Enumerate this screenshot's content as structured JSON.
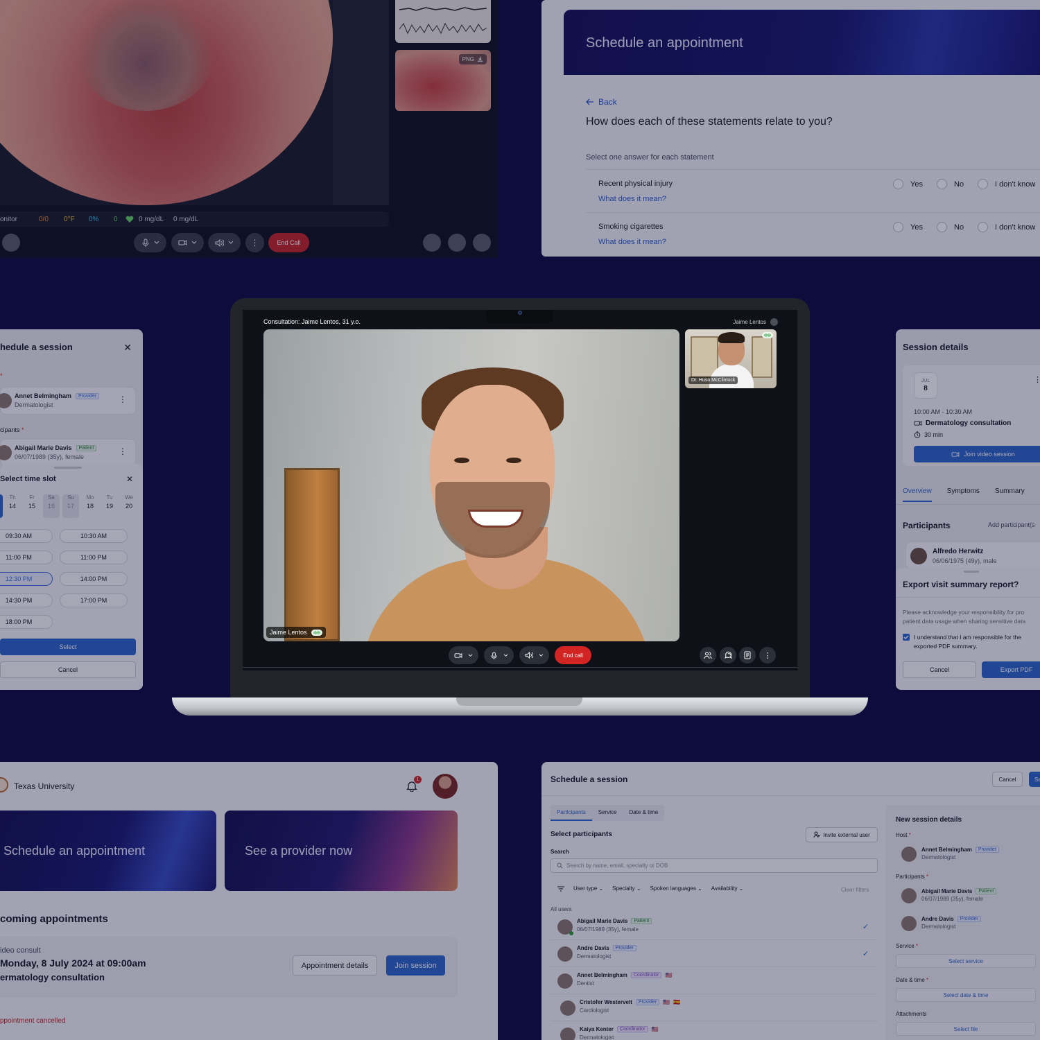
{
  "telehealth": {
    "vitals_label": "onitor",
    "vitals": [
      "0/0",
      "0°F",
      "0%",
      "0",
      "0 mg/dL",
      "0 mg/dL"
    ],
    "thumb_badge": "PNG",
    "end_call": "End Call"
  },
  "questionnaire": {
    "title": "Schedule an appointment",
    "back": "Back",
    "question": "How does each of these statements relate to you?",
    "hint": "Select one answer for each statement",
    "options": [
      "Yes",
      "No",
      "I don't know"
    ],
    "statements": [
      {
        "label": "Recent physical injury",
        "link": "What does it mean?"
      },
      {
        "label": "Smoking cigarettes",
        "link": "What does it mean?"
      }
    ]
  },
  "call": {
    "consultation": "Consultation: Jaime Lentos, 31 y.o.",
    "top_right_name": "Jaime Lentos",
    "main_name": "Jaime Lentos",
    "pip_name": "Dr. Huso McClintock",
    "end_call": "End call"
  },
  "time_slot": {
    "title": "hedule a session",
    "host": {
      "name": "Annet Belmingham",
      "badge": "Provider",
      "sub": "Dermatologist"
    },
    "participants_label": "cipants",
    "participant": {
      "name": "Abigail Marie Davis",
      "badge": "Patient",
      "sub": "06/07/1989 (35y), female"
    },
    "sheet_title": "Select time slot",
    "days": [
      {
        "d": "Th",
        "n": "14"
      },
      {
        "d": "Fr",
        "n": "15"
      },
      {
        "d": "Sa",
        "n": "16"
      },
      {
        "d": "Su",
        "n": "17"
      },
      {
        "d": "Mo",
        "n": "18"
      },
      {
        "d": "Tu",
        "n": "19"
      },
      {
        "d": "We",
        "n": "20"
      }
    ],
    "slots": [
      "09:30 AM",
      "10:30 AM",
      "11:00 PM",
      "11:00 PM",
      "12:30 PM",
      "14:00 PM",
      "14:30 PM",
      "17:00 PM",
      "18:00 PM"
    ],
    "selected_slot": "12:30 PM",
    "select": "Select",
    "cancel": "Cancel"
  },
  "session_details": {
    "title": "Session details",
    "month": "JUL",
    "day": "8",
    "time": "10:00 AM - 10:30 AM",
    "type": "Dermatology consultation",
    "duration": "30 min",
    "join": "Join video session",
    "tabs": [
      "Overview",
      "Symptoms",
      "Summary"
    ],
    "participants": "Participants",
    "add": "Add participant(s",
    "participant": {
      "name": "Alfredo Herwitz",
      "sub": "06/06/1975 (49y), male"
    },
    "export_title": "Export visit summary report?",
    "export_text": [
      "Please acknowledge your responsibility for pro",
      "patient data usage when sharing sensitive data"
    ],
    "checkbox": [
      "I understand that I am responsible for the",
      "exported PDF summary."
    ],
    "cancel": "Cancel",
    "export": "Export PDF"
  },
  "dashboard": {
    "org": "Texas University",
    "notifications": "1",
    "cta_1": "Schedule an appointment",
    "cta_2": "See a provider now",
    "upcoming": "coming appointments",
    "apt_kind": "ideo consult",
    "apt_date": "Monday, 8 July 2024 at 09:00am",
    "apt_title": "ermatology consultation",
    "apt_details": "Appointment details",
    "join": "Join session",
    "cancelled": "ppointment cancelled"
  },
  "schedule_session": {
    "title": "Schedule a session",
    "cancel": "Cancel",
    "save": "Sa",
    "tabs": [
      "Participants",
      "Service",
      "Date & time"
    ],
    "select_participants": "Select participants",
    "invite": "Invite external user",
    "search_label": "Search",
    "search_placeholder": "Search by name, email, specialty or DOB",
    "filters": [
      "User type",
      "Specialty",
      "Spoken languages",
      "Availability"
    ],
    "clear": "Clear filters",
    "all_users": "All users",
    "users": [
      {
        "name": "Abigail Marie Davis",
        "badge": "Patient",
        "sub": "06/07/1989 (35y), female",
        "checked": true
      },
      {
        "name": "Andre Davis",
        "badge": "Provider",
        "sub": "Dermatologist",
        "checked": true
      },
      {
        "name": "Annet Belmingham",
        "badge": "Coordinator",
        "sub": "Dentist",
        "checked": false
      },
      {
        "name": "Cristofer Westervelt",
        "badge": "Provider",
        "sub": "Cardiologist",
        "checked": false
      },
      {
        "name": "Kaiya Kenter",
        "badge": "Coordinator",
        "sub": "Dermatologist",
        "checked": false
      }
    ],
    "new_details": "New session details",
    "host_label": "Host",
    "host": {
      "name": "Annet Belmingham",
      "badge": "Provider",
      "sub": "Dermatologist"
    },
    "participants_label": "Participants",
    "participants": [
      {
        "name": "Abigail Marie Davis",
        "badge": "Patient",
        "sub": "06/07/1989 (35y), female"
      },
      {
        "name": "Andre Davis",
        "badge": "Provider",
        "sub": "Dermatologist"
      }
    ],
    "service_label": "Service",
    "select_service": "Select service",
    "date_label": "Date & time",
    "select_date": "Select date & time",
    "attachments": "Attachments",
    "select_file": "Select file"
  },
  "colors": {
    "background": "#0d0c3d",
    "accent": "#2f68c9",
    "danger": "#c62828",
    "patient_badge": "#2c7b3b"
  }
}
